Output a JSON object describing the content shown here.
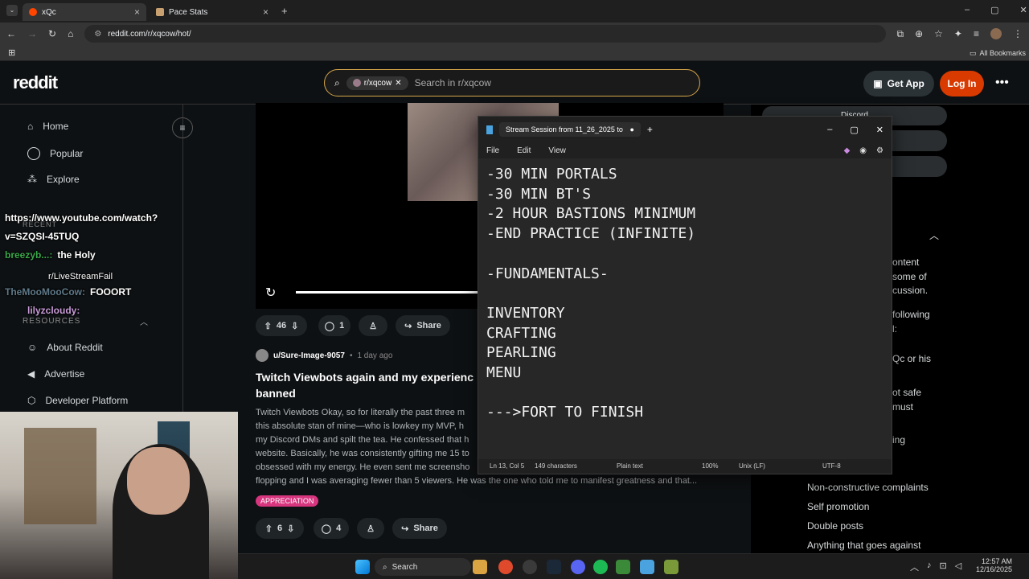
{
  "browser": {
    "tabs": [
      {
        "label": "xQc",
        "active": true
      },
      {
        "label": "Pace Stats",
        "active": false
      }
    ],
    "url": "reddit.com/r/xqcow/hot/",
    "bookmarks_label": "All Bookmarks"
  },
  "reddit": {
    "logo": "reddit",
    "search": {
      "chip": "r/xqcow",
      "placeholder": "Search in r/xqcow"
    },
    "get_app": "Get App",
    "login": "Log In",
    "nav": [
      {
        "label": "Home"
      },
      {
        "label": "Popular"
      },
      {
        "label": "Explore"
      }
    ],
    "nav_bottom": [
      {
        "label": "About Reddit"
      },
      {
        "label": "Advertise"
      },
      {
        "label": "Developer Platform"
      }
    ],
    "resources_label": "RESOURCES",
    "recent_label": "RECENT",
    "post1": {
      "upvotes": "46",
      "comments": "1",
      "share": "Share"
    },
    "post2": {
      "author": "u/Sure-Image-9057",
      "age": "1 day ago",
      "title_line1": "Twitch Viewbots again and my experienc",
      "title_line2": "banned",
      "body": [
        "Twitch Viewbots Okay, so for literally the past three m",
        "this absolute stan of mine—who is lowkey my MVP, h",
        "my Discord DMs and spilt the tea. He confessed that h",
        "website. Basically, he was consistently gifting me 15 to",
        "obsessed with my energy. He even sent me screensho",
        "flopping and I was averaging fewer than 5 viewers. He was the one who told me to manifest greatness and that..."
      ],
      "flair": "APPRECIATION",
      "upvotes": "6",
      "comments": "4",
      "share": "Share"
    },
    "sidebar": {
      "discord": "Discord",
      "rules_text": [
        "ontent",
        "some of",
        "cussion.",
        "following",
        "l:",
        "Qc or his",
        "ot safe",
        "must",
        "ing"
      ],
      "rules": [
        "Non-constructive complaints",
        "Self promotion",
        "Double posts",
        "Anything that goes against"
      ]
    }
  },
  "chat_overlay": [
    {
      "user": "",
      "text": "https://www.youtube.com/watch?"
    },
    {
      "user": "",
      "text": "v=SZQSI-45TUQ"
    },
    {
      "user": "breezyb...:",
      "text": "the Holy"
    },
    {
      "user": "",
      "text": "r/LiveStreamFail"
    },
    {
      "user": "TheMooMooCow:",
      "text": "FOOORT"
    },
    {
      "user": "lilyzcloudy:",
      "text": ""
    }
  ],
  "notepad": {
    "title": "Stream Session from 11_26_2025 to",
    "menu": [
      "File",
      "Edit",
      "View"
    ],
    "content": "-30 MIN PORTALS\n-30 MIN BT'S\n-2 HOUR BASTIONS MINIMUM\n-END PRACTICE (INFINITE)\n\n-FUNDAMENTALS-\n\nINVENTORY\nCRAFTING\nPEARLING\nMENU\n\n--->FORT TO FINISH",
    "status": {
      "position": "Ln 13, Col 5",
      "chars": "149 characters",
      "format": "Plain text",
      "zoom": "100%",
      "line_ending": "Unix (LF)",
      "encoding": "UTF-8"
    }
  },
  "taskbar": {
    "search": "Search",
    "time": "12:57 AM",
    "date": "12/16/2025"
  }
}
